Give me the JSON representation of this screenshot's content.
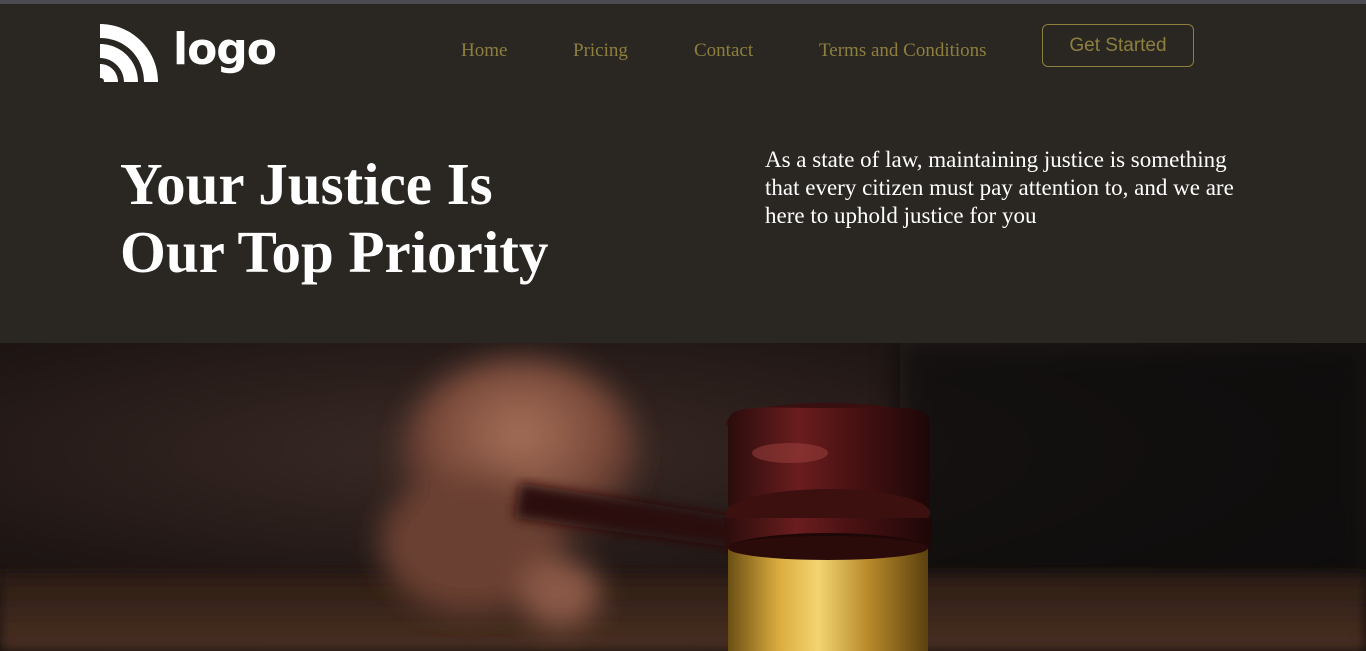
{
  "brand": {
    "logo_text": "logo",
    "logo_icon": "signal-arcs-icon"
  },
  "nav": {
    "items": [
      {
        "label": "Home"
      },
      {
        "label": "Pricing"
      },
      {
        "label": "Contact"
      },
      {
        "label": "Terms and Conditions"
      }
    ],
    "cta_label": "Get Started"
  },
  "hero": {
    "title_line1": "Your Justice Is",
    "title_line2": "Our Top Priority",
    "description": "As a state of law, maintaining justice is something that every citizen must pay attention to, and we are here to uphold justice for you"
  },
  "colors": {
    "header_bg": "#2a2722",
    "accent": "#8d7f3e",
    "text": "#ffffff"
  },
  "image": {
    "subject": "gavel-photo"
  }
}
